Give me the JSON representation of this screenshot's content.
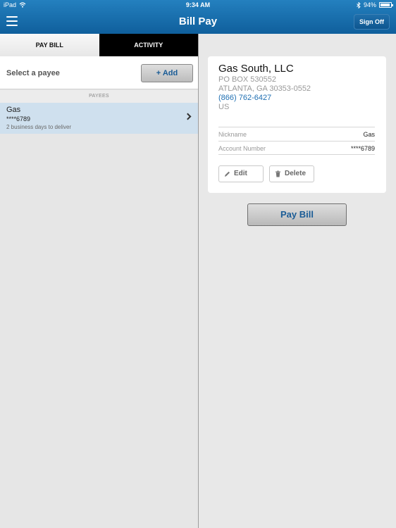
{
  "status_bar": {
    "device": "iPad",
    "time": "9:34 AM",
    "battery": "94%",
    "battery_level": 0.94
  },
  "nav": {
    "title": "Bill Pay",
    "sign_off_label": "Sign Off"
  },
  "tabs": [
    {
      "label": "PAY BILL",
      "active": true
    },
    {
      "label": "ACTIVITY",
      "active": false
    }
  ],
  "payees_panel": {
    "select_label": "Select a payee",
    "add_label": "+ Add",
    "section_header": "PAYEES",
    "payees": [
      {
        "name": "Gas",
        "account": "****6789",
        "delivery": "2 business days to deliver"
      }
    ]
  },
  "payee_detail": {
    "name": "Gas South, LLC",
    "address_line1": "PO BOX 530552",
    "address_line2": "ATLANTA, GA 30353-0552",
    "phone": "(866) 762-6427",
    "country": "US",
    "nickname_label": "Nickname",
    "nickname_value": "Gas",
    "account_label": "Account Number",
    "account_value": "****6789",
    "edit_label": "Edit",
    "delete_label": "Delete"
  },
  "pay_bill_button": "Pay Bill",
  "colors": {
    "nav_blue": "#1a6fad",
    "accent_text": "#1a5c96",
    "selected_row": "#cfe0ee",
    "link": "#1f6fb2"
  },
  "icons": {
    "menu": "hamburger-icon",
    "wifi": "wifi-icon",
    "bluetooth": "bluetooth-icon",
    "battery": "battery-icon",
    "chevron": "chevron-right-icon",
    "edit": "pencil-icon",
    "delete": "trash-icon"
  }
}
